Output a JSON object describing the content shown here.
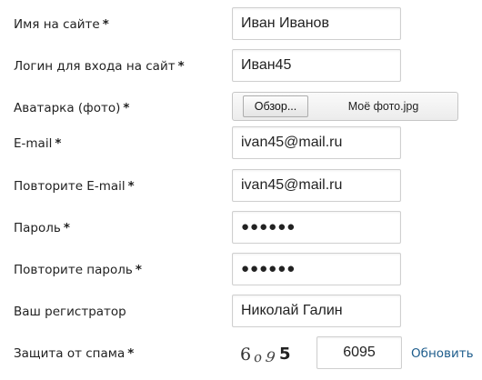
{
  "required_mark": "*",
  "fields": {
    "name": {
      "label": "Имя на сайте",
      "value": "Иван Иванов"
    },
    "login": {
      "label": "Логин для входа на сайт",
      "value": "Иван45"
    },
    "avatar": {
      "label": "Аватарка (фото)",
      "button_label": "Обзор...",
      "file_name": "Моё фото.jpg"
    },
    "email": {
      "label": "E-mail",
      "value": "ivan45@mail.ru"
    },
    "email_repeat": {
      "label": "Повторите E-mail",
      "value": "ivan45@mail.ru"
    },
    "password": {
      "label": "Пароль",
      "value": "●●●●●●"
    },
    "password_repeat": {
      "label": "Повторите пароль",
      "value": "●●●●●●"
    },
    "registrar": {
      "label": "Ваш регистратор",
      "value": "Николай Галин"
    },
    "captcha": {
      "label": "Защита от спама",
      "image_text": "6095",
      "value": "6095",
      "refresh_label": "Обновить"
    }
  },
  "colors": {
    "link": "#1e5d8c",
    "border": "#cfcfcf"
  }
}
